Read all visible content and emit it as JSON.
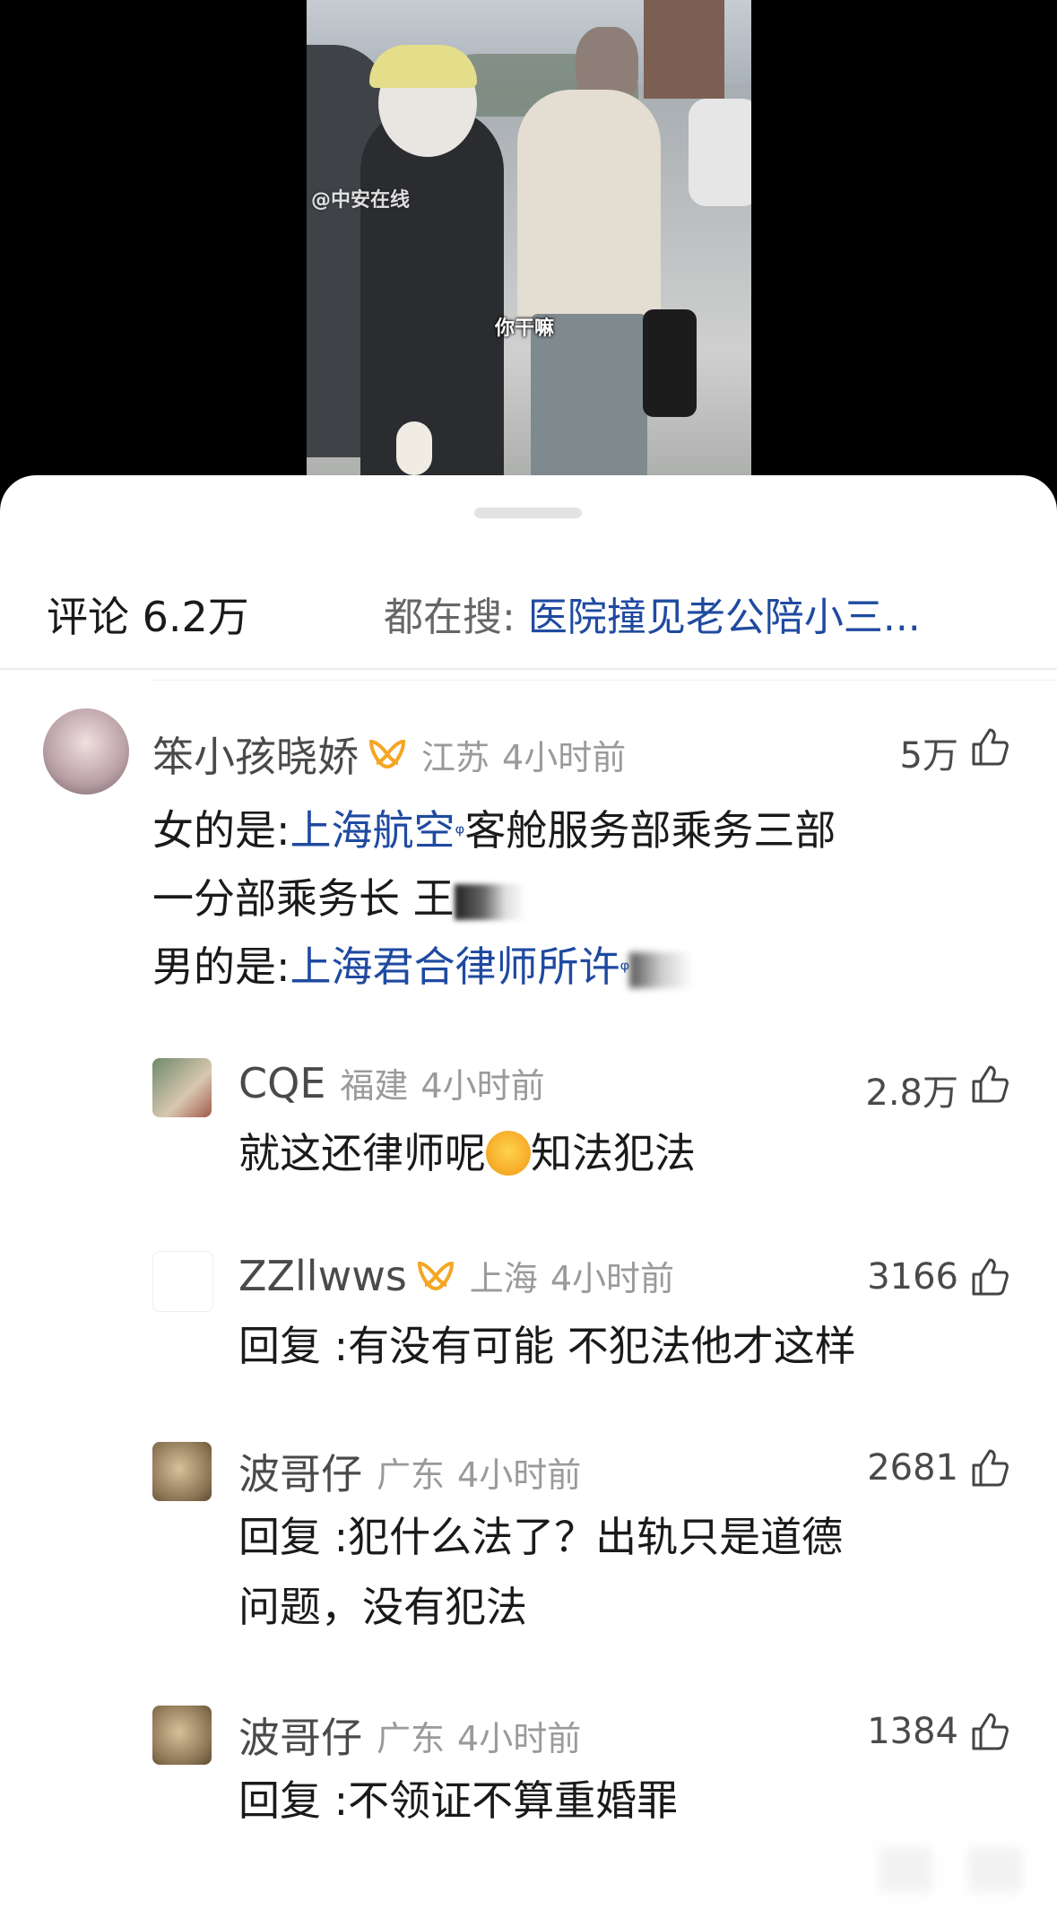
{
  "video": {
    "watermark": "@中安在线",
    "subtitle": "你干嘛"
  },
  "header": {
    "comments_label": "评论 6.2万",
    "trending_label": "都在搜:",
    "trending_link": "医院撞见老公陪小三..."
  },
  "comments": [
    {
      "username": "笨小孩晓娇",
      "region": "江苏",
      "time": "4小时前",
      "likes": "5万",
      "line1_prefix": "女的是:",
      "line1_link": "上海航空",
      "line1_suffix": "客舱服务部乘务三部",
      "line2": "一分部乘务长 王",
      "line3_prefix": "男的是:",
      "line3_link": "上海君合律师所许",
      "line3_suffix": "",
      "search_mark": "ᵠ"
    },
    {
      "username": "CQE",
      "region": "福建",
      "time": "4小时前",
      "likes": "2.8万",
      "text_before": "就这还律师呢",
      "text_after": "知法犯法"
    },
    {
      "username": "ZZllwws",
      "region": "上海",
      "time": "4小时前",
      "likes": "3166",
      "text": "回复 :有没有可能 不犯法他才这样"
    },
    {
      "username": "波哥仔",
      "region": "广东",
      "time": "4小时前",
      "likes": "2681",
      "line1": "回复 :犯什么法了？出轨只是道德",
      "line2": "问题，没有犯法"
    },
    {
      "username": "波哥仔",
      "region": "广东",
      "time": "4小时前",
      "likes": "1384",
      "text": "回复 :不领证不算重婚罪"
    }
  ],
  "icons": {
    "like": "thumbs-up-icon",
    "badge": "vip-badge-icon",
    "emoji": "crying-laughing-emoji"
  },
  "colors": {
    "link": "#1f4aa0",
    "badge": "#f5a623"
  }
}
